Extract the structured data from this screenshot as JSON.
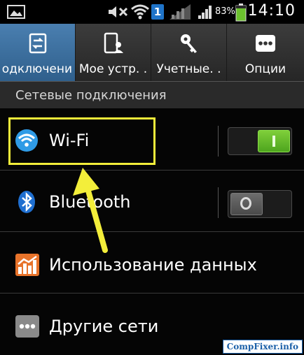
{
  "status_bar": {
    "battery_percent": "83%",
    "time": "14:10",
    "notification_badge": "1",
    "icons": [
      "gallery-icon",
      "mute-icon",
      "wifi-signal-icon",
      "notification-badge-icon",
      "no-signal-icon",
      "cell-signal-icon",
      "battery-icon"
    ]
  },
  "tabs": [
    {
      "label": "одключени",
      "icon": "connections-icon",
      "active": true
    },
    {
      "label": "Мое устр. .",
      "icon": "my-device-icon",
      "active": false
    },
    {
      "label": "Учетные. .",
      "icon": "accounts-key-icon",
      "active": false
    },
    {
      "label": "Опции",
      "icon": "options-dots-icon",
      "active": false
    }
  ],
  "section_title": "Сетевые подключения",
  "rows": [
    {
      "label": "Wi-Fi",
      "icon": "wifi-icon",
      "toggle": "on"
    },
    {
      "label": "Bluetooth",
      "icon": "bluetooth-icon",
      "toggle": "off"
    },
    {
      "label": "Использование данных",
      "icon": "data-usage-icon"
    },
    {
      "label": "Другие сети",
      "icon": "more-networks-icon"
    }
  ],
  "annotation": {
    "highlight_color": "#f3ee3a",
    "arrow_color": "#f3ee3a"
  },
  "watermark": "CompFixer.info",
  "colors": {
    "active_tab": "#3f74a4",
    "toggle_on": "#6cc22e",
    "wifi_icon": "#2f9be6",
    "data_icon": "#e8732a"
  }
}
